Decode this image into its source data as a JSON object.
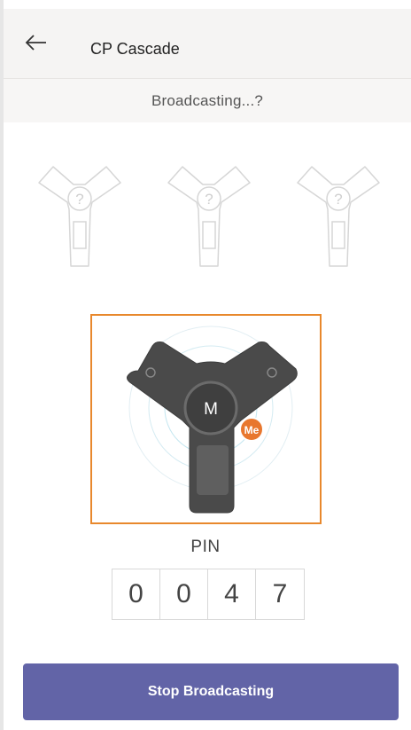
{
  "header": {
    "title": "CP Cascade",
    "back_icon": "arrow-left-icon"
  },
  "status": {
    "text": "Broadcasting...?"
  },
  "slots": [
    {
      "icon": "question-mark-icon",
      "symbol": "?"
    },
    {
      "icon": "question-mark-icon",
      "symbol": "?"
    },
    {
      "icon": "question-mark-icon",
      "symbol": "?"
    }
  ],
  "device": {
    "center_label": "M",
    "badge_label": "Me",
    "badge_color": "#e8772e"
  },
  "pin": {
    "label": "PIN",
    "digits": [
      "0",
      "0",
      "4",
      "7"
    ]
  },
  "actions": {
    "stop_label": "Stop Broadcasting",
    "stop_color": "#6264a7"
  },
  "colors": {
    "accent_frame": "#e8882c"
  }
}
